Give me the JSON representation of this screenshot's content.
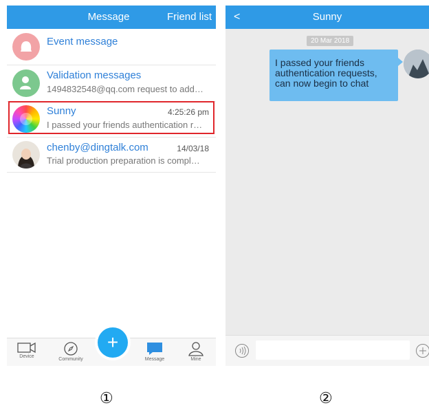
{
  "screen1": {
    "tabs": {
      "message": "Message",
      "friend_list": "Friend list"
    },
    "rows": [
      {
        "name": "Event message",
        "sub": "",
        "time": ""
      },
      {
        "name": "Validation messages",
        "sub": "1494832548@qq.com request to add…",
        "time": ""
      },
      {
        "name": "Sunny",
        "sub": "I passed your friends authentication r…",
        "time": "4:25:26 pm"
      },
      {
        "name": "chenby@dingtalk.com",
        "sub": "Trial production preparation is compl…",
        "time": "14/03/18"
      }
    ],
    "tabbar": {
      "device": "Device",
      "community": "Community",
      "add": "+",
      "message": "Message",
      "mine": "Mine"
    }
  },
  "screen2": {
    "back": "<",
    "title": "Sunny",
    "date": "20 Mar 2018",
    "bubble": "I passed your friends authentication requests, can now begin to chat"
  },
  "captions": [
    "①",
    "②"
  ],
  "colors": {
    "header_blue": "#2f9ae6",
    "fab_blue": "#22aaf2",
    "bubble_blue": "#6ebcf0",
    "highlight_red": "#e0262b"
  }
}
